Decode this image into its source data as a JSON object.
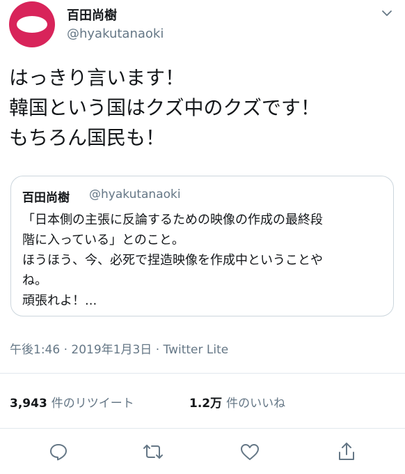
{
  "tweet": {
    "author_name": "百田尚樹",
    "author_handle": "@hyakutanaoki",
    "text_lines": [
      "はっきり言います！",
      "韓国という国はクズ中のクズです！",
      "もちろん国民も！"
    ],
    "timestamp": "午後1:46",
    "date": "2019年1月3日",
    "separator": "·",
    "source": "Twitter Lite"
  },
  "quoted": {
    "author_name": "百田尚樹",
    "author_handle": "@hyakutanaoki",
    "text_lines": [
      "「日本側の主張に反論するための映像の作成の最終段",
      "階に入っている」とのこと。",
      "ほうほう、今、必死で捏造映像を作成中ということや",
      "ね。",
      "頑張れよ！..."
    ]
  },
  "stats": {
    "retweets_count": "3,943",
    "retweets_label": "件のリツイート",
    "likes_count": "1.2万",
    "likes_label": "件のいいね"
  },
  "icons": {
    "menu": "chevron-down-icon",
    "reply": "reply-icon",
    "retweet": "retweet-icon",
    "like": "heart-icon",
    "share": "share-icon"
  },
  "colors": {
    "avatar": "#d8245a",
    "secondary_text": "#657786",
    "border": "#ccd6dd",
    "icon": "#657786"
  }
}
